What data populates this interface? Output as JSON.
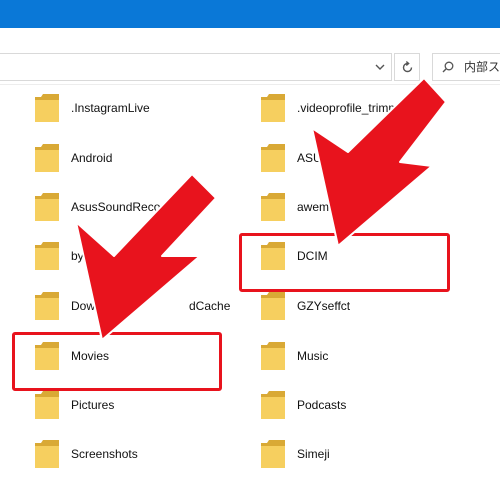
{
  "toolbar": {
    "search_placeholder": "内部スト"
  },
  "folders": [
    {
      "name": ".InstagramLive"
    },
    {
      "name": ".videoprofile_trimm"
    },
    {
      "name": "Android"
    },
    {
      "name": "ASUS"
    },
    {
      "name": "AsusSoundReco"
    },
    {
      "name": "aweme_"
    },
    {
      "name": "byted"
    },
    {
      "name": "DCIM"
    },
    {
      "name": "Down"
    },
    {
      "name": "dCache"
    },
    {
      "name": "GZYseffct"
    },
    {
      "name": "Movies"
    },
    {
      "name": "Music"
    },
    {
      "name": "Pictures"
    },
    {
      "name": "Podcasts"
    },
    {
      "name": "Screenshots"
    },
    {
      "name": "Simeji"
    }
  ],
  "colors": {
    "titlebar": "#0a78d7",
    "annotation_red": "#e8131d",
    "folder_yellow": "#f6cf5f"
  },
  "icons": {
    "folder": "folder-icon",
    "dropdown": "chevron-down-icon",
    "refresh": "refresh-icon",
    "search": "search-icon",
    "arrow": "arrow-annotation"
  }
}
